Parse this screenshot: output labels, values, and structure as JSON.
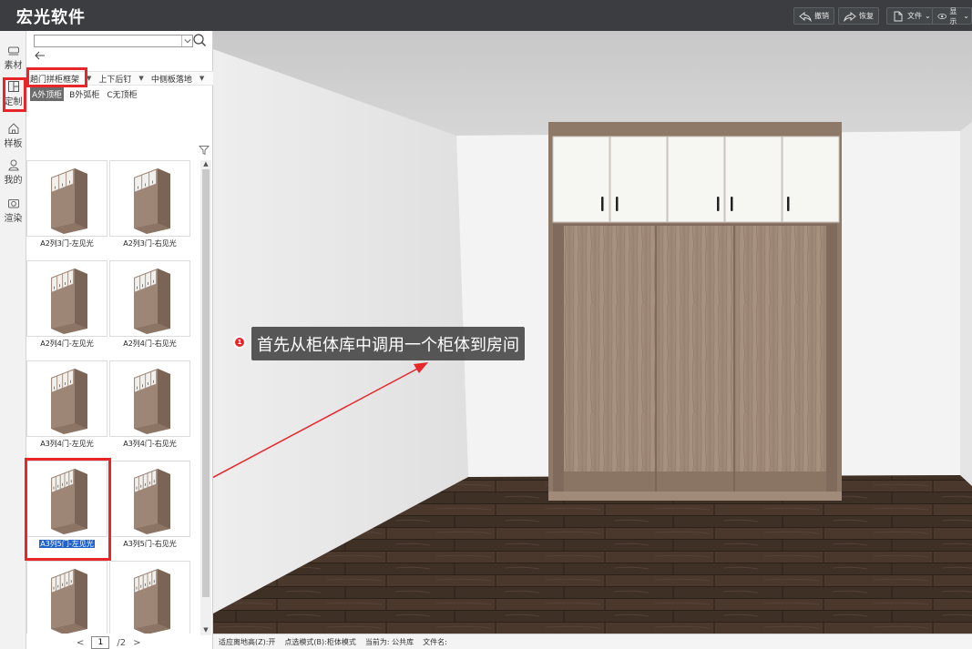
{
  "app": {
    "title": "宏光软件"
  },
  "toolbar": {
    "undo": "撤销",
    "redo": "恢复",
    "file": "文件",
    "display": "显示"
  },
  "rail": [
    {
      "label": "素材",
      "icon": "material-icon"
    },
    {
      "label": "定制",
      "icon": "custom-icon"
    },
    {
      "label": "样板",
      "icon": "template-icon"
    },
    {
      "label": "我的",
      "icon": "user-icon"
    },
    {
      "label": "渲染",
      "icon": "camera-icon"
    }
  ],
  "panel": {
    "search_value": "",
    "filters": [
      "趟门拼柜框架",
      "上下后钉",
      "中侧板落地"
    ],
    "sub_tabs": [
      "A外顶柜",
      "B外弧柜",
      "C无顶柜"
    ],
    "items": [
      "A2列3门-左见光",
      "A2列3门-右见光",
      "A2列4门-左见光",
      "A2列4门-右见光",
      "A3列4门-左见光",
      "A3列4门-右见光",
      "A3列5门-左见光",
      "A3列5门-右见光",
      "",
      ""
    ],
    "selected_index": 6,
    "pager": {
      "prev": "<",
      "current": "1",
      "total": "/2",
      "next": ">"
    }
  },
  "annotation": {
    "number": "1",
    "text": "首先从柜体库中调用一个柜体到房间"
  },
  "status": {
    "floor_height": "适应离地高(Z):开",
    "select_mode": "点选模式(B):柜体模式",
    "current": "当前为: 公共库",
    "file_name": "文件名:"
  },
  "colors": {
    "annotation_red": "#e8262a",
    "selection_blue": "#1f63c9",
    "topbar": "#3b3d40"
  }
}
